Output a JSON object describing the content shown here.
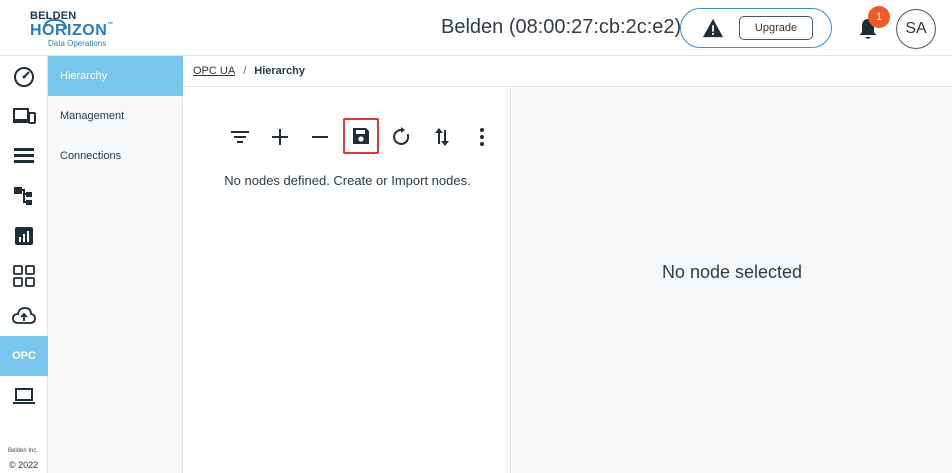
{
  "header": {
    "logo": {
      "line1": "BELDEN",
      "line2": "HORIZON",
      "tm": "™",
      "line3": "Data Operations"
    },
    "device_title": "Belden (08:00:27:cb:2c:e2)",
    "upgrade_label": "Upgrade",
    "notification_count": "1",
    "avatar_initials": "SA"
  },
  "rail": {
    "icons": [
      "dashboard-icon",
      "devices-icon",
      "list-icon",
      "hierarchy-icon",
      "analytics-icon",
      "apps-grid-icon",
      "cloud-upload-icon",
      "opc-item",
      "laptop-icon"
    ],
    "opc_label": "OPC",
    "active_color": "#79c6ec",
    "footer_company": "Belden Inc.",
    "footer_copyright": "© 2022"
  },
  "submenu": {
    "items": [
      {
        "label": "Hierarchy",
        "active": true
      },
      {
        "label": "Management",
        "active": false
      },
      {
        "label": "Connections",
        "active": false
      }
    ]
  },
  "breadcrumb": {
    "root": "OPC UA",
    "separator": "/",
    "current": "Hierarchy"
  },
  "toolbar": {
    "buttons": [
      "filter-icon",
      "add-icon",
      "remove-icon",
      "save-icon",
      "refresh-icon",
      "sort-icon",
      "more-icon"
    ],
    "highlight_color": "#e03636"
  },
  "left_panel": {
    "empty_message": "No nodes defined. Create or Import nodes."
  },
  "right_panel": {
    "placeholder": "No node selected"
  }
}
